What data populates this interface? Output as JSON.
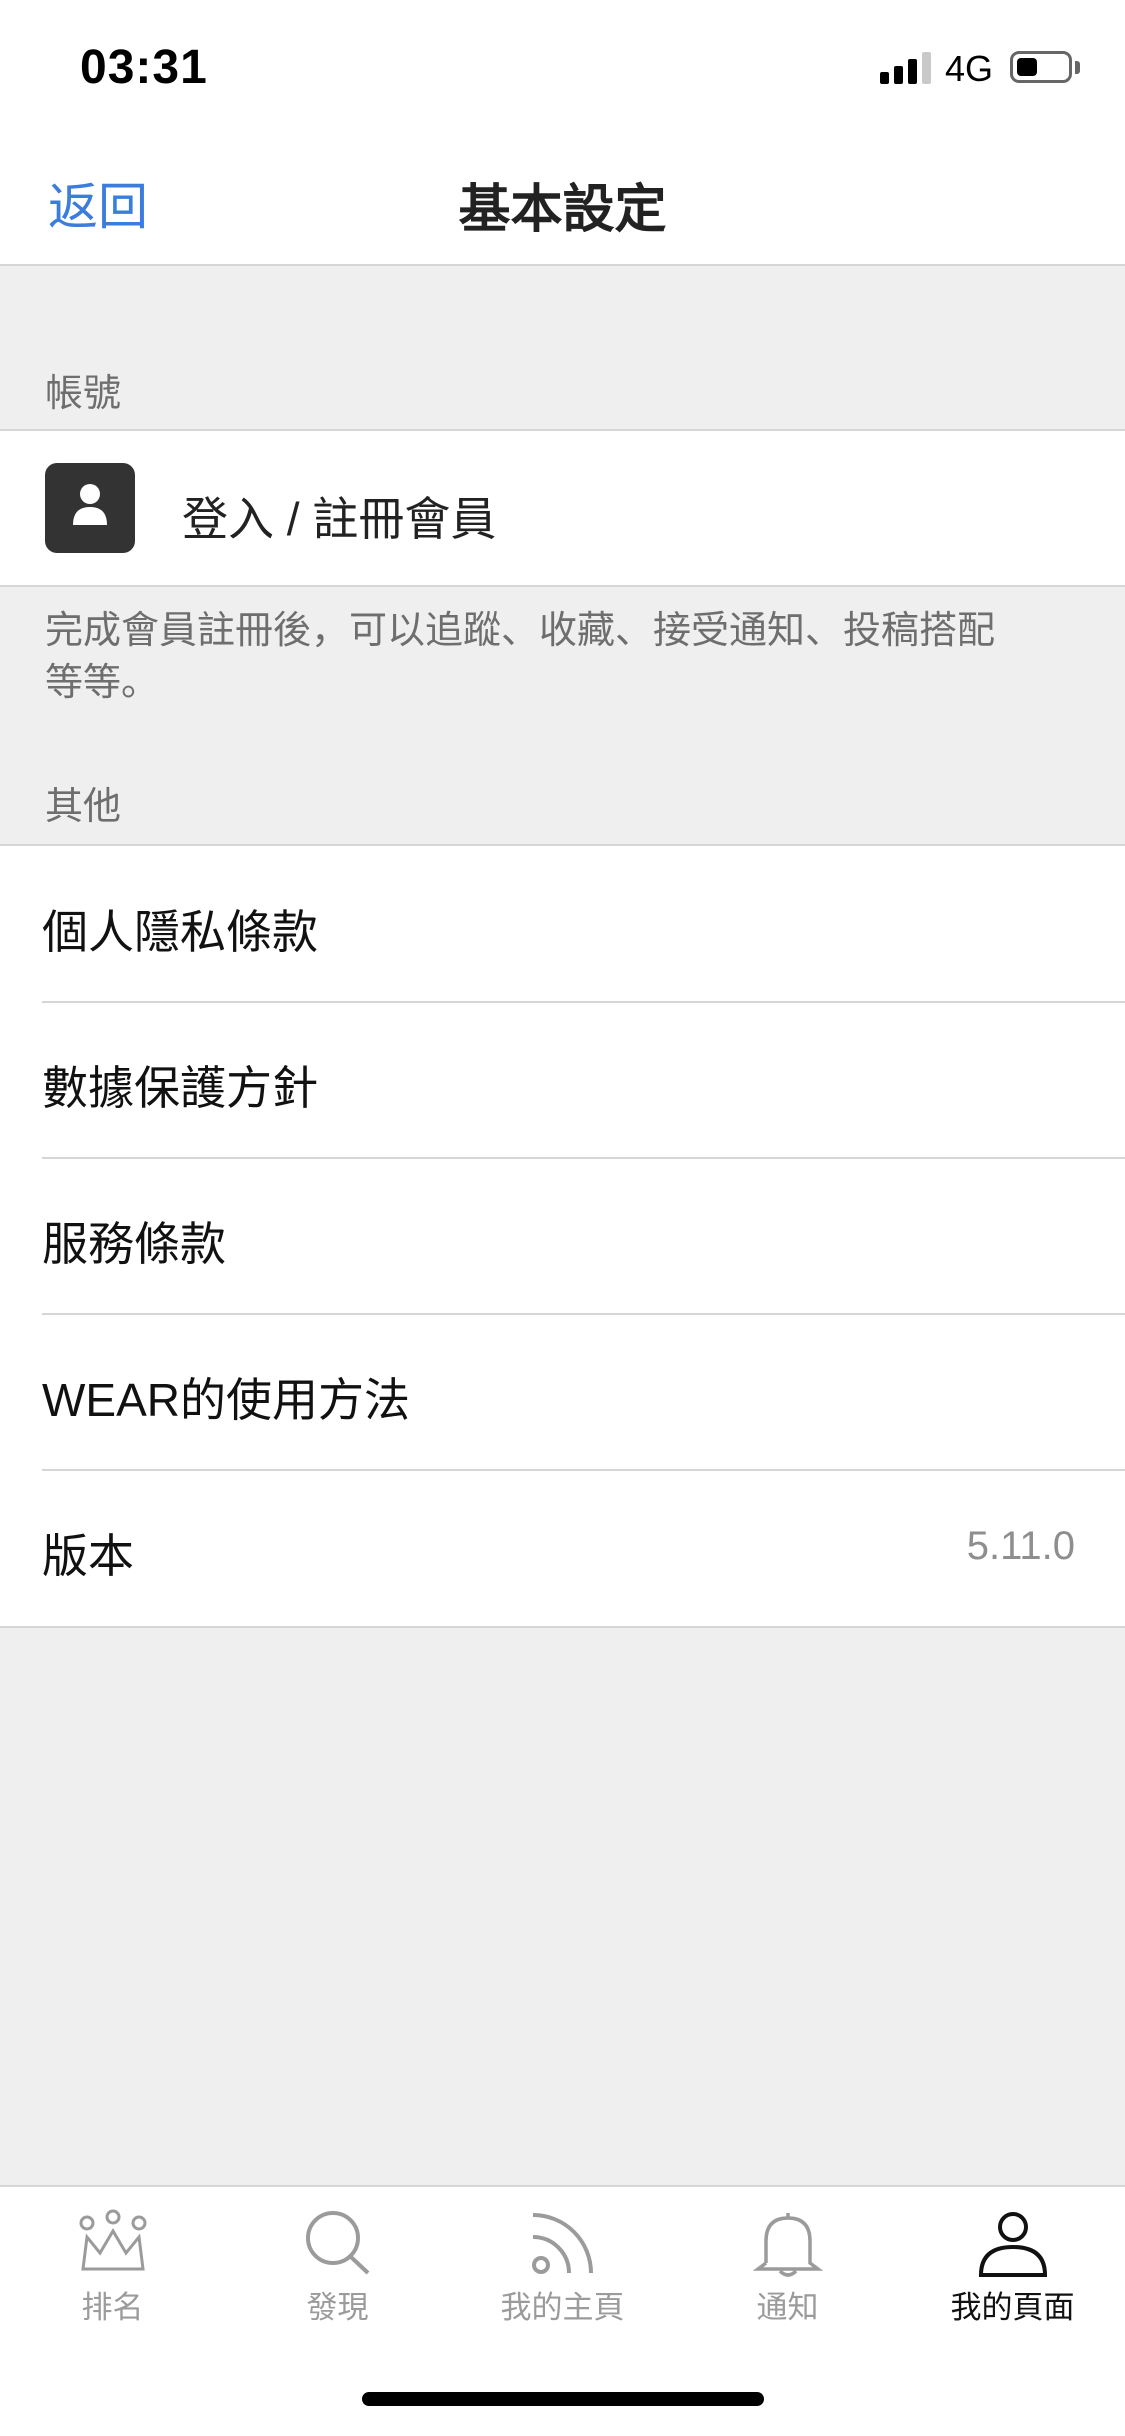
{
  "status_bar": {
    "time": "03:31",
    "network": "4G",
    "signal_icon": "cellular-signal-icon",
    "battery_icon": "battery-icon"
  },
  "nav": {
    "back_label": "返回",
    "title": "基本設定"
  },
  "account_section": {
    "header": "帳號",
    "login_label": "登入 / 註冊會員",
    "login_icon": "person-icon",
    "footer_note": "完成會員註冊後，可以追蹤、收藏、接受通知、投稿搭配等等。"
  },
  "other_section": {
    "header": "其他",
    "items": [
      {
        "label": "個人隱私條款"
      },
      {
        "label": "數據保護方針"
      },
      {
        "label": "服務條款"
      },
      {
        "label": "WEAR的使用方法"
      },
      {
        "label": "版本",
        "value": "5.11.0"
      }
    ]
  },
  "tab_bar": {
    "tabs": [
      {
        "label": "排名",
        "icon": "crown-icon",
        "active": false
      },
      {
        "label": "發現",
        "icon": "search-icon",
        "active": false
      },
      {
        "label": "我的主頁",
        "icon": "feed-icon",
        "active": false
      },
      {
        "label": "通知",
        "icon": "bell-icon",
        "active": false
      },
      {
        "label": "我的頁面",
        "icon": "person-icon",
        "active": true
      }
    ]
  },
  "colors": {
    "accent": "#3b7ddd",
    "background": "#efefef",
    "active_tab": "#111111",
    "inactive_tab": "#9b9b9b"
  }
}
